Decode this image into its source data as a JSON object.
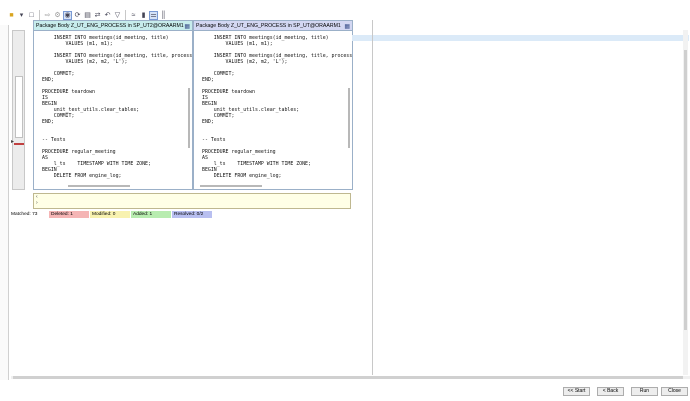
{
  "toolbar": {
    "icons": [
      "package-icon",
      "dropdown-icon",
      "copy-left-icon",
      "copy-right-icon",
      "gear-icon",
      "eye-icon",
      "refresh-icon",
      "layout-icon",
      "ignore-icon",
      "undo-icon",
      "next-diff-icon",
      "first-diff-icon",
      "sync-icon",
      "layout-vertical-icon"
    ]
  },
  "left_pane": {
    "title": "Package Body Z_UT_ENG_PROCESS in SP_UT2@ORAARM1",
    "code": "    INSERT INTO meetings(id_meeting, title)\n        VALUES (m1, m1);\n\n    INSERT INTO meetings(id_meeting, title, process\n        VALUES (m2, m2, 'L');\n\n    COMMIT;\nEND;\n\nPROCEDURE teardown\nIS\nBEGIN\n    unit_test_utils.clear_tables;\n    COMMIT;\nEND;\n\n\n-- Tests\n\nPROCEDURE regular_meeting\nAS\n    l_ts    TIMESTAMP WITH TIME ZONE;\nBEGIN\n    DELETE FROM engine_log;"
  },
  "right_pane": {
    "title": "Package Body Z_UT_ENG_PROCESS in SP_UT@ORAARM1",
    "code": "    INSERT INTO meetings(id_meeting, title)\n        VALUES (m1, m1);\n\n    INSERT INTO meetings(id_meeting, title, process\n        VALUES (m2, m2, 'L');\n\n    COMMIT;\nEND;\n\nPROCEDURE teardown\nIS\nBEGIN\n    unit_test_utils.clear_tables;\n    COMMIT;\nEND;\n\n\n-- Tests\n\nPROCEDURE regular_meeting\nAS\n    l_ts    TIMESTAMP WITH TIME ZONE;\nBEGIN\n    DELETE FROM engine_log;"
  },
  "status": {
    "matched": "Matched: 73",
    "deleted": "Deleted: 1",
    "modified": "Modified: 0",
    "added": "Added: 1",
    "resolved": "Resolved: 0/2"
  },
  "buttons": {
    "start": "<< Start",
    "back": "< Back",
    "run": "Run",
    "close": "Close"
  },
  "colors": {
    "left_title_bg": "#c7ecec",
    "right_title_bg": "#d3d7f2",
    "deleted": "#f5b5b5",
    "modified": "#f8f2b0",
    "added": "#b8ecb0",
    "resolved": "#b8bff0",
    "editbox_bg": "#ffffe6"
  }
}
